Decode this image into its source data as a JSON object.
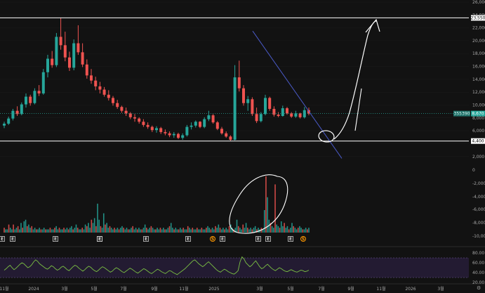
{
  "chart_data": [
    {
      "type": "candlestick",
      "ylim": [
        0,
        26000
      ],
      "y_ticks": [
        "26,000",
        "24,000",
        "22,000",
        "20,000",
        "18,000",
        "16,000",
        "14,000",
        "12,000",
        "10,000",
        "8,000",
        "6,000"
      ],
      "price_levels": [
        {
          "label": "23,550",
          "value": 23550,
          "color": "#ffffff"
        },
        {
          "label": "4,400",
          "value": 4400,
          "color": "#ffffff"
        }
      ],
      "current_price": {
        "label": "8,670",
        "ticker": "355390",
        "value": 8670,
        "color": "#26a69a"
      },
      "candles": [
        [
          6800,
          7400,
          6400,
          7100
        ],
        [
          7100,
          8200,
          6900,
          7900
        ],
        [
          7900,
          9400,
          7600,
          9100
        ],
        [
          9100,
          9800,
          8300,
          8600
        ],
        [
          8600,
          10400,
          8400,
          10100
        ],
        [
          10100,
          11800,
          9600,
          11300
        ],
        [
          11300,
          11600,
          9900,
          10300
        ],
        [
          10300,
          12600,
          10100,
          12200
        ],
        [
          12200,
          13100,
          11400,
          11800
        ],
        [
          11800,
          15600,
          11600,
          15100
        ],
        [
          15100,
          17800,
          14300,
          17200
        ],
        [
          17200,
          18400,
          15800,
          16200
        ],
        [
          16200,
          21200,
          15900,
          20600
        ],
        [
          20600,
          23550,
          18600,
          19300
        ],
        [
          19300,
          21400,
          16800,
          17400
        ],
        [
          17400,
          18300,
          15300,
          15800
        ],
        [
          15800,
          20200,
          15400,
          19600
        ],
        [
          19600,
          22400,
          17800,
          18200
        ],
        [
          18200,
          19600,
          15900,
          16300
        ],
        [
          16300,
          17100,
          14100,
          14600
        ],
        [
          14600,
          15600,
          13300,
          13800
        ],
        [
          13800,
          14400,
          12300,
          12900
        ],
        [
          12900,
          13600,
          11800,
          12400
        ],
        [
          12400,
          12800,
          11300,
          11600
        ],
        [
          11600,
          12300,
          10700,
          11100
        ],
        [
          11100,
          11400,
          9900,
          10300
        ],
        [
          10300,
          10800,
          9400,
          9700
        ],
        [
          9700,
          9900,
          8800,
          9100
        ],
        [
          9100,
          9600,
          8300,
          8700
        ],
        [
          8700,
          8900,
          7800,
          8100
        ],
        [
          8100,
          8600,
          7400,
          7900
        ],
        [
          7900,
          8100,
          7100,
          7400
        ],
        [
          7400,
          7800,
          6600,
          6900
        ],
        [
          6900,
          7300,
          6300,
          6600
        ],
        [
          6600,
          6800,
          5800,
          6100
        ],
        [
          6100,
          6700,
          5700,
          6400
        ],
        [
          6400,
          6600,
          5500,
          5800
        ],
        [
          5800,
          6200,
          5300,
          5600
        ],
        [
          5600,
          5900,
          5000,
          5300
        ],
        [
          5300,
          5800,
          4900,
          5500
        ],
        [
          5500,
          5700,
          4700,
          4900
        ],
        [
          4900,
          5600,
          4600,
          5300
        ],
        [
          5300,
          6900,
          5100,
          6600
        ],
        [
          6600,
          7300,
          6200,
          6800
        ],
        [
          6800,
          7600,
          6500,
          7400
        ],
        [
          7400,
          7500,
          6400,
          6600
        ],
        [
          6600,
          8100,
          6400,
          7800
        ],
        [
          7800,
          9100,
          7500,
          8400
        ],
        [
          8400,
          8600,
          7100,
          7300
        ],
        [
          7300,
          7500,
          6100,
          6300
        ],
        [
          6300,
          6600,
          5400,
          5600
        ],
        [
          5600,
          5900,
          4900,
          5100
        ],
        [
          5100,
          5300,
          4450,
          4600
        ],
        [
          4600,
          16200,
          4500,
          14300
        ],
        [
          14300,
          16900,
          12100,
          12600
        ],
        [
          12600,
          13100,
          9900,
          10300
        ],
        [
          10300,
          11400,
          9100,
          10900
        ],
        [
          10900,
          11200,
          8300,
          8600
        ],
        [
          8600,
          9600,
          7200,
          7500
        ],
        [
          7500,
          8900,
          7300,
          8600
        ],
        [
          8600,
          11600,
          8400,
          11100
        ],
        [
          11100,
          11300,
          9100,
          9400
        ],
        [
          9400,
          9800,
          8200,
          8500
        ],
        [
          8500,
          8900,
          8100,
          8300
        ],
        [
          8300,
          9900,
          8200,
          9500
        ],
        [
          9500,
          9700,
          8500,
          8700
        ],
        [
          8700,
          8900,
          8000,
          8200
        ],
        [
          8200,
          9100,
          8000,
          8700
        ],
        [
          8700,
          8800,
          7900,
          8100
        ],
        [
          8100,
          9700,
          7900,
          9200
        ],
        [
          9200,
          9600,
          8400,
          8670
        ]
      ],
      "trendline": {
        "start_value": 21500,
        "end_value": 1700,
        "color": "#4a5ac8"
      },
      "annotations": [
        "circle",
        "arrow-up",
        "up-stroke"
      ]
    },
    {
      "type": "bar",
      "name": "volume",
      "y_ticks": [
        "2,000",
        "0",
        "-2,000",
        "-4,000",
        "-6,000",
        "-8,000",
        "-10,000"
      ],
      "values": [
        3,
        2,
        2,
        5,
        3,
        2,
        5,
        2,
        3,
        4,
        2,
        6,
        3,
        7,
        8,
        4,
        5,
        3,
        4,
        2,
        3,
        2,
        2,
        3,
        2,
        2,
        3,
        2,
        2,
        2,
        3,
        2,
        2,
        3,
        4,
        2,
        3,
        2,
        2,
        3,
        2,
        3,
        2,
        3,
        4,
        2,
        3,
        5,
        3,
        2,
        2,
        3,
        2,
        5,
        4,
        6,
        3,
        8,
        6,
        9,
        4,
        18,
        8,
        4,
        3,
        12,
        5,
        6,
        3,
        4,
        3,
        2,
        3,
        2,
        3,
        2,
        3,
        4,
        3,
        2,
        3,
        2,
        2,
        3,
        4,
        2,
        3,
        2,
        3,
        2,
        2,
        3,
        5,
        3,
        2,
        3,
        4,
        3,
        2,
        2,
        3,
        2,
        3,
        2,
        3,
        2,
        2,
        3,
        4,
        6,
        3,
        2,
        3,
        2,
        2,
        3,
        2,
        3,
        2,
        2,
        4,
        3,
        2,
        3,
        2,
        2,
        3,
        2,
        2,
        3,
        2,
        2,
        3,
        4,
        3,
        2,
        3,
        2,
        4,
        3,
        5,
        3,
        2,
        3,
        2,
        3,
        2,
        4,
        5,
        3,
        2,
        3,
        8,
        4,
        3,
        2,
        5,
        3,
        6,
        3,
        2,
        3,
        2,
        3,
        4,
        2,
        3,
        2,
        3,
        2,
        14,
        35,
        22,
        8,
        6,
        4,
        3,
        30,
        5,
        4,
        3,
        7,
        4,
        6,
        3,
        4,
        2,
        3,
        6,
        4,
        3,
        2,
        3,
        4,
        3,
        2,
        2,
        3,
        2,
        3
      ],
      "events": [
        "E",
        "E",
        "E",
        "E",
        "E",
        "E",
        "E",
        "S",
        "E",
        "E",
        "E",
        "S",
        "E"
      ]
    },
    {
      "type": "line",
      "name": "rsi",
      "y_ticks": [
        "80.00",
        "60.00",
        "40.00",
        "20.00"
      ],
      "ylim": [
        20,
        80
      ],
      "values": [
        45,
        48,
        52,
        55,
        50,
        46,
        49,
        53,
        57,
        60,
        58,
        54,
        50,
        52,
        56,
        62,
        66,
        63,
        58,
        55,
        52,
        49,
        47,
        50,
        54,
        52,
        48,
        45,
        47,
        51,
        53,
        50,
        46,
        44,
        48,
        52,
        55,
        53,
        49,
        46,
        43,
        46,
        50,
        53,
        51,
        47,
        44,
        42,
        45,
        49,
        52,
        50,
        47,
        44,
        41,
        43,
        47,
        50,
        48,
        45,
        42,
        40,
        43,
        46,
        49,
        47,
        44,
        41,
        39,
        42,
        45,
        48,
        46,
        43,
        40,
        38,
        41,
        44,
        47,
        45,
        42,
        40,
        38,
        41,
        44,
        43,
        40,
        38,
        36,
        39,
        42,
        45,
        48,
        52,
        56,
        60,
        64,
        66,
        62,
        58,
        55,
        52,
        55,
        59,
        62,
        58,
        54,
        50,
        46,
        43,
        41,
        44,
        47,
        45,
        42,
        40,
        38,
        37,
        40,
        44,
        62,
        72,
        68,
        60,
        56,
        52,
        55,
        60,
        64,
        58,
        52,
        48,
        50,
        54,
        57,
        53,
        49,
        46,
        44,
        47,
        50,
        48,
        45,
        43,
        42,
        44,
        46,
        44,
        42,
        41,
        43,
        45,
        44,
        42,
        43,
        45
      ],
      "band": [
        30,
        70
      ]
    }
  ],
  "x_ticks": [
    "11월",
    "2024",
    "3월",
    "5월",
    "7월",
    "9월",
    "11월",
    "2025",
    "3월",
    "5월",
    "7월",
    "9월",
    "11월",
    "2026",
    "3월",
    "5월"
  ],
  "corner_labels": {
    "bottom": "⚙"
  }
}
